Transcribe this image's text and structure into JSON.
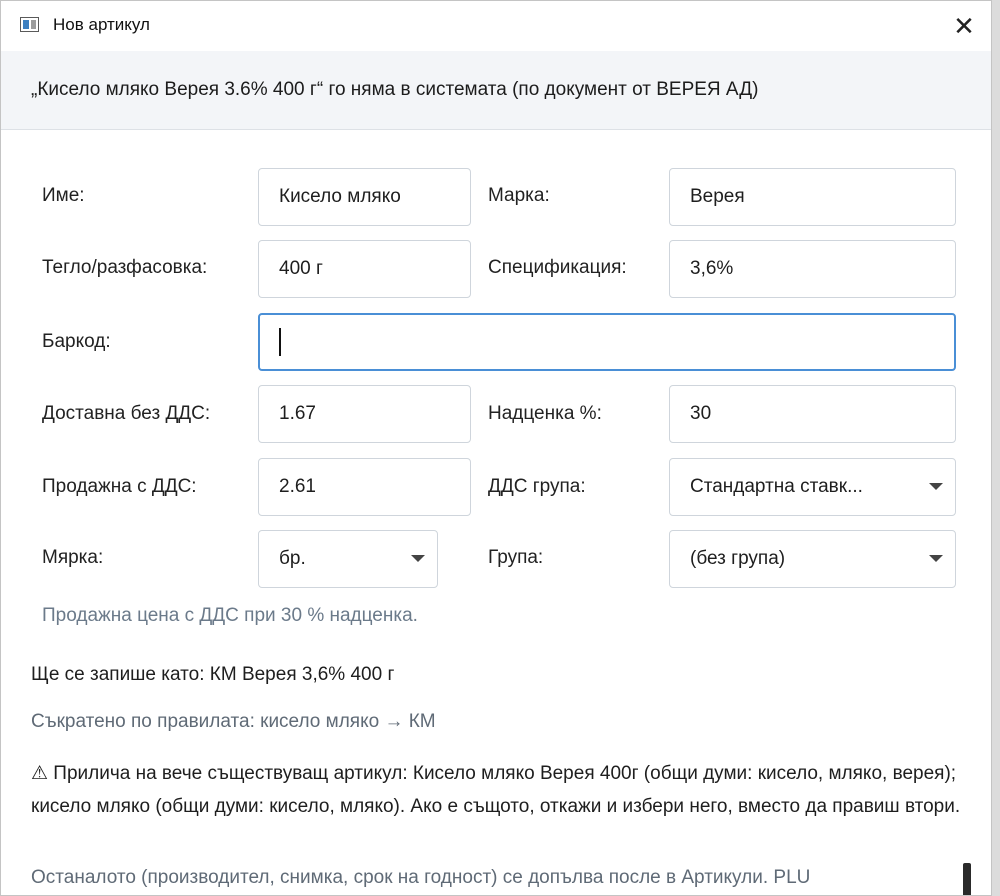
{
  "window": {
    "title": "Нов артикул",
    "close_glyph": "✕"
  },
  "header": {
    "text": "„Кисело мляко Верея 3.6% 400 г“ го няма в системата (по документ от ВЕРЕЯ АД)"
  },
  "form": {
    "name": {
      "label": "Име:",
      "value": "Кисело мляко"
    },
    "brand": {
      "label": "Марка:",
      "value": "Верея"
    },
    "weight": {
      "label": "Тегло/разфасовка:",
      "value": "400 г"
    },
    "spec": {
      "label": "Спецификация:",
      "value": "3,6%"
    },
    "barcode": {
      "label": "Баркод:",
      "value": ""
    },
    "delivery_price": {
      "label": "Доставна без ДДС:",
      "value": "1.67"
    },
    "markup": {
      "label": "Надценка %:",
      "value": "30"
    },
    "sale_price": {
      "label": "Продажна с ДДС:",
      "value": "2.61"
    },
    "vat_group": {
      "label": "ДДС група:",
      "value": "Стандартна ставк..."
    },
    "unit": {
      "label": "Мярка:",
      "value": "бр."
    },
    "group": {
      "label": "Група:",
      "value": "(без група)"
    }
  },
  "hint": "Продажна цена с ДДС при 30 % надценка.",
  "save_as": "Ще се запише като: КМ Верея 3,6% 400 г",
  "shortened": "Съкратено по правилата: кисело мляко → КМ",
  "warning": "⚠ Прилича на вече съществуващ артикул: Кисело мляко Верея 400г (общи думи: кисело, мляко, верея); кисело мляко (общи думи: кисело, мляко). Ако е същото, откажи и избери него, вместо да правиш втори.",
  "rest_note": "Останалото (производител, снимка, срок на годност) се допълва после в Артикули. PLU",
  "colors": {
    "focus_border": "#4a8fd6",
    "field_border": "#cfd5dc",
    "banner_bg": "#f3f5f8",
    "hint_text": "#6b7a8a"
  }
}
